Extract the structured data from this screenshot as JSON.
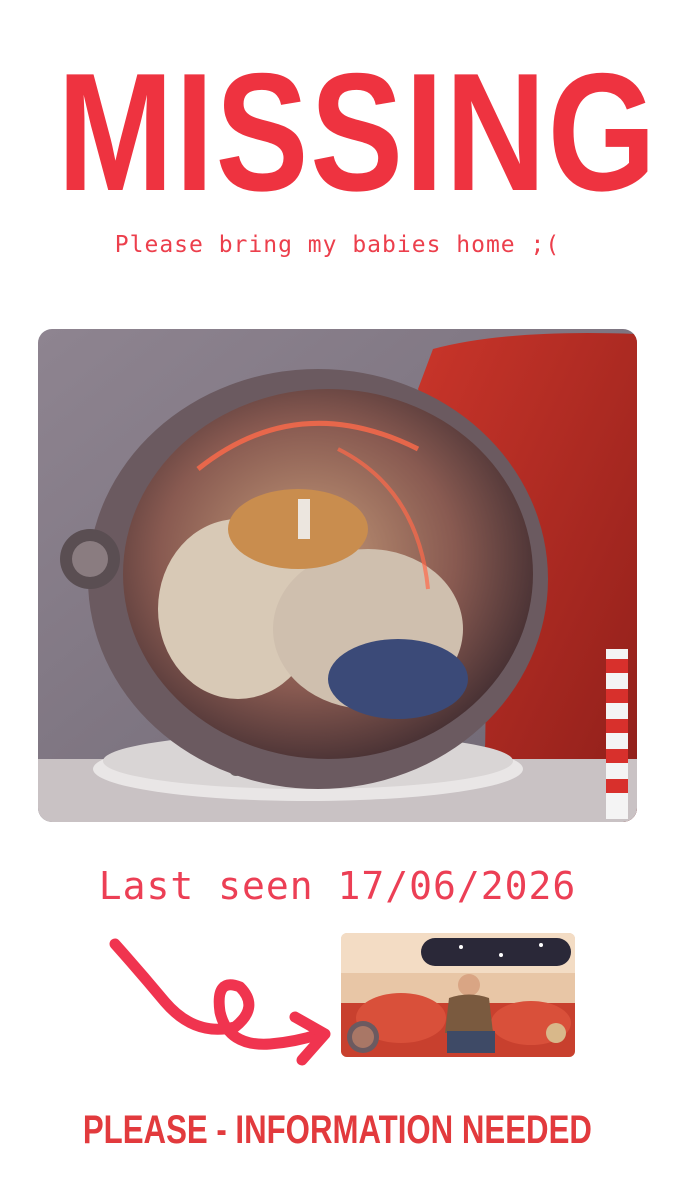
{
  "poster": {
    "title": "MISSING",
    "subtitle": "Please bring my babies home ;(",
    "last_seen": "Last seen 17/06/2026",
    "footer": "PLEASE - INFORMATION NEEDED"
  },
  "colors": {
    "title_red": "#ee3340",
    "text_red": "#ec3f4c",
    "arrow_red": "#f0344f"
  },
  "icons": {
    "arrow": "curly-arrow-icon"
  }
}
